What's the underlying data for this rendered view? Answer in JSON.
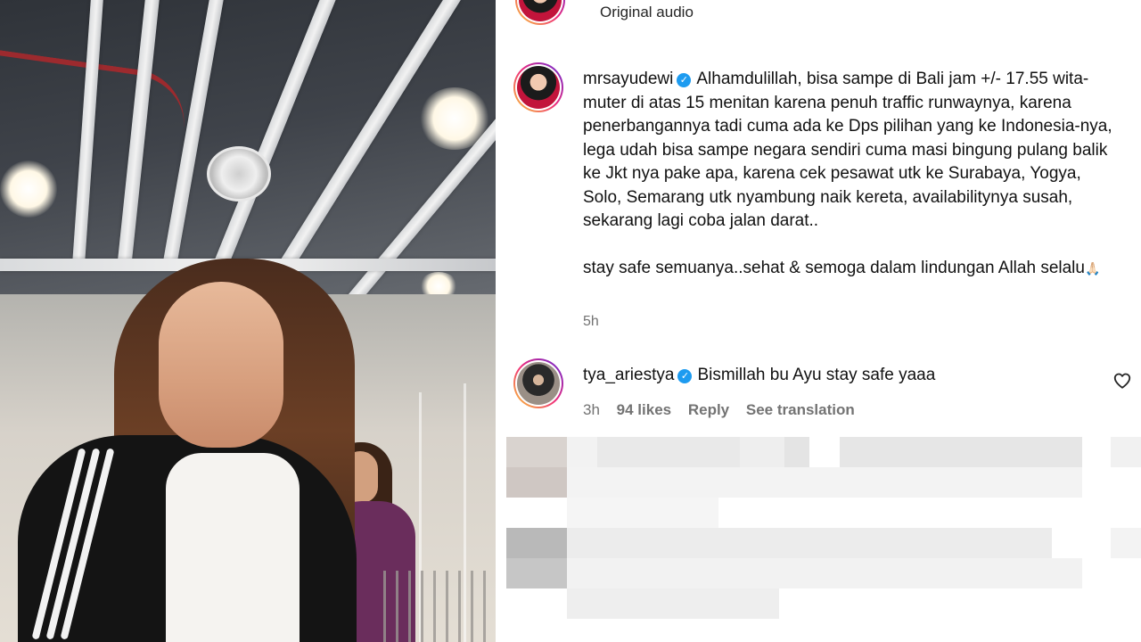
{
  "top": {
    "audio_label": "Original audio",
    "more_icon": "•••"
  },
  "post": {
    "username": "mrsayudewi",
    "verified_icon": "✓",
    "caption_main": "Alhamdulillah, bisa sampe di Bali jam +/- 17.55 wita-muter di atas 15 menitan karena penuh traffic runwaynya, karena penerbangannya tadi cuma ada ke Dps pilihan yang ke Indonesia-nya, lega udah bisa sampe negara sendiri cuma masi bingung pulang balik ke Jkt nya pake apa, karena cek pesawat utk ke Surabaya, Yogya, Solo, Semarang utk nyambung naik kereta, availabilitynya susah, sekarang lagi coba jalan darat..",
    "caption_second": "stay safe semuanya..sehat & semoga dalam lindungan Allah selalu",
    "caption_emoji": "🙏🏻",
    "time_ago": "5h"
  },
  "comment": {
    "username": "tya_ariestya",
    "verified_icon": "✓",
    "text": "Bismillah bu Ayu stay safe yaaa",
    "time_ago": "3h",
    "likes": "94 likes",
    "reply_label": "Reply",
    "translate_label": "See translation",
    "heart_icon": "heart-outline-icon"
  },
  "colors": {
    "verified": "#1d9bf0",
    "secondary_text": "#737373",
    "primary_text": "#111111"
  }
}
